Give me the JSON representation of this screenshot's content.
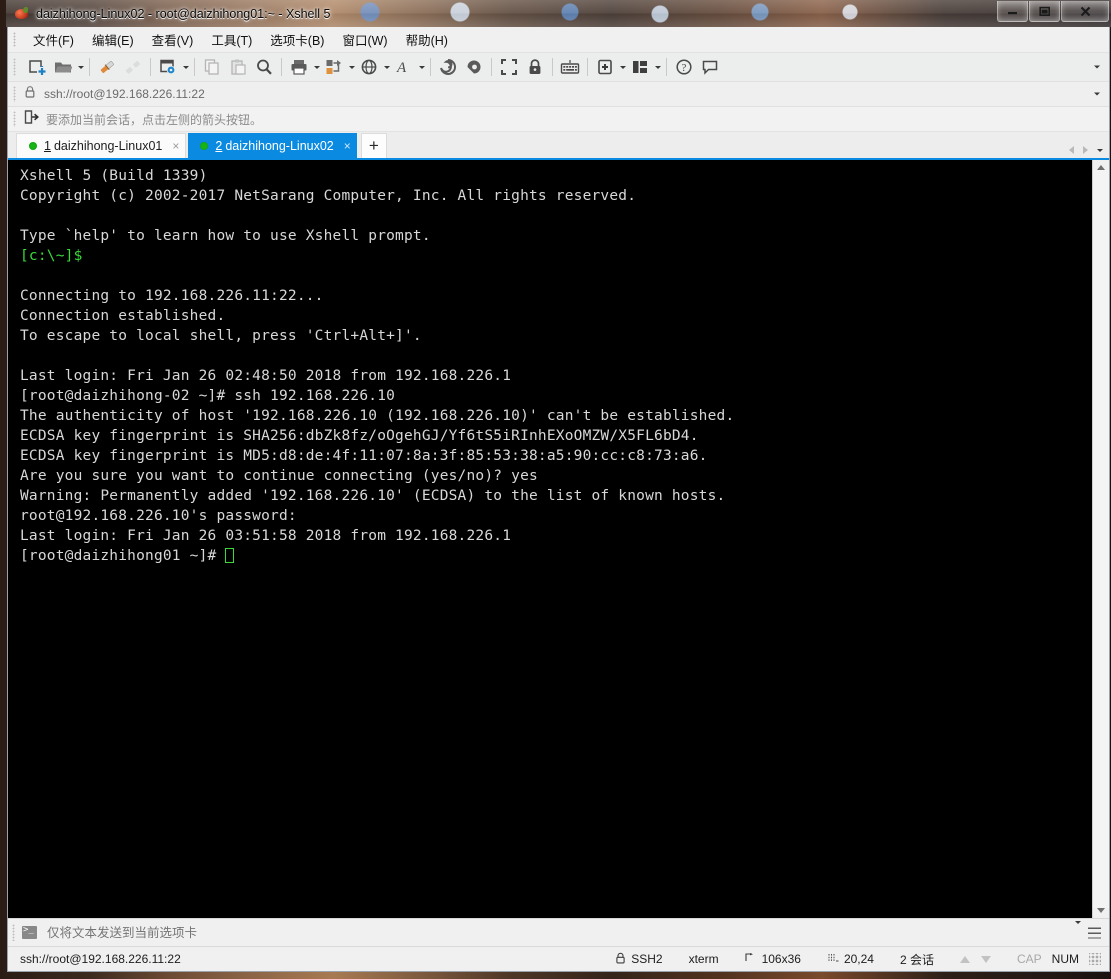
{
  "window": {
    "title": "daizhihong-Linux02 - root@daizhihong01:~ - Xshell 5",
    "minimize_label": "Minimize",
    "maximize_label": "Maximize",
    "close_label": "Close"
  },
  "menubar": [
    {
      "label": "文件(F)",
      "name": "menu-file"
    },
    {
      "label": "编辑(E)",
      "name": "menu-edit"
    },
    {
      "label": "查看(V)",
      "name": "menu-view"
    },
    {
      "label": "工具(T)",
      "name": "menu-tools"
    },
    {
      "label": "选项卡(B)",
      "name": "menu-tabs"
    },
    {
      "label": "窗口(W)",
      "name": "menu-window"
    },
    {
      "label": "帮助(H)",
      "name": "menu-help"
    }
  ],
  "toolbar": {
    "icons": [
      "new-session-icon",
      "open-folder-icon",
      "connect-icon",
      "disconnect-icon",
      "session-properties-icon",
      "copy-icon",
      "paste-icon",
      "find-icon",
      "print-icon",
      "transfer-icon",
      "browser-icon",
      "font-icon",
      "xftp-icon",
      "xagent-icon",
      "fullscreen-icon",
      "lock-icon",
      "keyboard-icon",
      "add-to-favorites-icon",
      "arrange-layout-icon",
      "help-icon",
      "feedback-icon"
    ],
    "overflow_label": "More toolbar buttons"
  },
  "address": {
    "lock_icon": "lock-icon",
    "value": "ssh://root@192.168.226.11:22",
    "dropdown_label": "History"
  },
  "hint": {
    "icon": "add-session-icon",
    "text": "要添加当前会话，点击左侧的箭头按钮。"
  },
  "tabs": {
    "items": [
      {
        "number": "1",
        "label": "daizhihong-Linux01",
        "active": false,
        "close_label": "×",
        "status": "connected"
      },
      {
        "number": "2",
        "label": "daizhihong-Linux02",
        "active": true,
        "close_label": "×",
        "status": "connected"
      }
    ],
    "new_tab_label": "+",
    "scroll_left_label": "Scroll tabs left",
    "scroll_right_label": "Scroll tabs right",
    "tab_list_label": "Tab list"
  },
  "terminal": {
    "lines": [
      {
        "text": "Xshell 5 (Build 1339)",
        "class": ""
      },
      {
        "text": "Copyright (c) 2002-2017 NetSarang Computer, Inc. All rights reserved.",
        "class": ""
      },
      {
        "text": "",
        "class": ""
      },
      {
        "text": "Type `help' to learn how to use Xshell prompt.",
        "class": ""
      },
      {
        "text": "[c:\\~]$",
        "class": "green"
      },
      {
        "text": "",
        "class": ""
      },
      {
        "text": "Connecting to 192.168.226.11:22...",
        "class": ""
      },
      {
        "text": "Connection established.",
        "class": ""
      },
      {
        "text": "To escape to local shell, press 'Ctrl+Alt+]'.",
        "class": ""
      },
      {
        "text": "",
        "class": ""
      },
      {
        "text": "Last login: Fri Jan 26 02:48:50 2018 from 192.168.226.1",
        "class": ""
      },
      {
        "text": "[root@daizhihong-02 ~]# ssh 192.168.226.10",
        "class": ""
      },
      {
        "text": "The authenticity of host '192.168.226.10 (192.168.226.10)' can't be established.",
        "class": ""
      },
      {
        "text": "ECDSA key fingerprint is SHA256:dbZk8fz/oOgehGJ/Yf6tS5iRInhEXoOMZW/X5FL6bD4.",
        "class": ""
      },
      {
        "text": "ECDSA key fingerprint is MD5:d8:de:4f:11:07:8a:3f:85:53:38:a5:90:cc:c8:73:a6.",
        "class": ""
      },
      {
        "text": "Are you sure you want to continue connecting (yes/no)? yes",
        "class": ""
      },
      {
        "text": "Warning: Permanently added '192.168.226.10' (ECDSA) to the list of known hosts.",
        "class": ""
      },
      {
        "text": "root@192.168.226.10's password:",
        "class": ""
      },
      {
        "text": "Last login: Fri Jan 26 03:51:58 2018 from 192.168.226.1",
        "class": ""
      }
    ],
    "prompt": "[root@daizhihong01 ~]# ",
    "scrollbar_up_label": "Scroll up",
    "scrollbar_down_label": "Scroll down"
  },
  "sendbar": {
    "icon": "terminal-icon",
    "placeholder": "仅将文本发送到当前选项卡",
    "value": "",
    "dropdown_label": "Send target",
    "menu_label": "Send options"
  },
  "statusbar": {
    "connection": "ssh://root@192.168.226.11:22",
    "protocol_icon": "lock-icon",
    "protocol": "SSH2",
    "terminal_type": "xterm",
    "size_icon": "resize-icon",
    "size": "106x36",
    "cursor_icon": "cursor-icon",
    "cursor_position": "20,24",
    "sessions": "2 会话",
    "transfer_up_label": "Upload",
    "transfer_down_label": "Download",
    "caps": "CAP",
    "num": "NUM"
  },
  "colors": {
    "accent": "#0a8ae0",
    "terminal_bg": "#000000",
    "terminal_fg": "#d8d8d8",
    "prompt_green": "#39d939",
    "tab_dot_green": "#17b317"
  }
}
